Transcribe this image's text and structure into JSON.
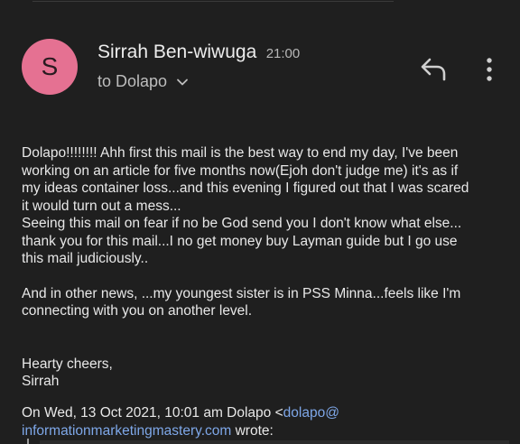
{
  "sender": {
    "initial": "S",
    "name": "Sirrah Ben-wiwuga",
    "time": "21:00",
    "avatar_color": "#e57192"
  },
  "recipient": {
    "label": "to Dolapo"
  },
  "icons": {
    "reply": "reply-icon",
    "more": "more-vert-icon",
    "expand": "chevron-down-icon"
  },
  "message": {
    "paragraph1": "Dolapo!!!!!!!! Ahh first this mail is the best way to end my day, I've been\nworking on an article for five months now(Ejoh don't judge me) it's as if\nmy ideas container loss...and this evening I figured out that I was scared\nit would turn out a mess...\nSeeing this mail on fear if no be God send you I don't know what else...\nthank you for this mail...I no get money buy Layman guide but I go use\nthis mail judiciously..",
    "paragraph2": "And in other news, ...my youngest sister is in PSS Minna...feels like I'm\nconnecting with you on another level.",
    "signoff": "Hearty cheers,\nSirrah"
  },
  "quote": {
    "prefix": "On Wed, 13 Oct 2021, 10:01 am Dolapo <",
    "email_part1": "dolapo@",
    "email_part2": "informationmarketingmastery.com",
    "suffix": " wrote:"
  },
  "colors": {
    "background": "#1f1f1f",
    "link": "#7ea7e8"
  }
}
